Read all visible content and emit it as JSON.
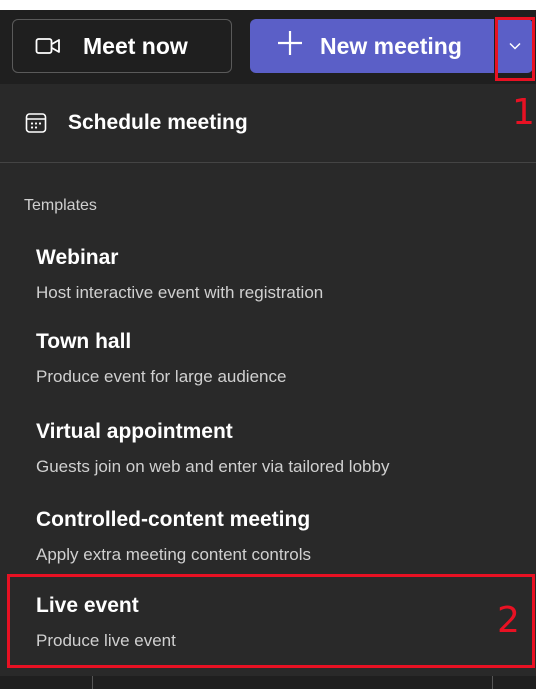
{
  "toolbar": {
    "meet_now_label": "Meet now",
    "meet_now_icon": "video-camera-icon",
    "new_meeting_label": "New meeting",
    "new_meeting_icon": "plus-icon",
    "dropdown_icon": "chevron-down-icon"
  },
  "menu": {
    "schedule_label": "Schedule meeting",
    "schedule_icon": "calendar-icon",
    "templates_heading": "Templates",
    "templates": [
      {
        "title": "Webinar",
        "description": "Host interactive event with registration"
      },
      {
        "title": "Town hall",
        "description": "Produce event for large audience"
      },
      {
        "title": "Virtual appointment",
        "description": "Guests join on web and enter via tailored lobby"
      },
      {
        "title": "Controlled-content meeting",
        "description": "Apply extra meeting content controls"
      },
      {
        "title": "Live event",
        "description": "Produce live event"
      }
    ]
  },
  "annotations": {
    "marker_1": "1",
    "marker_2": "2",
    "color": "#e81123"
  },
  "colors": {
    "accent": "#5b5fc7",
    "menu_bg": "#292929"
  }
}
